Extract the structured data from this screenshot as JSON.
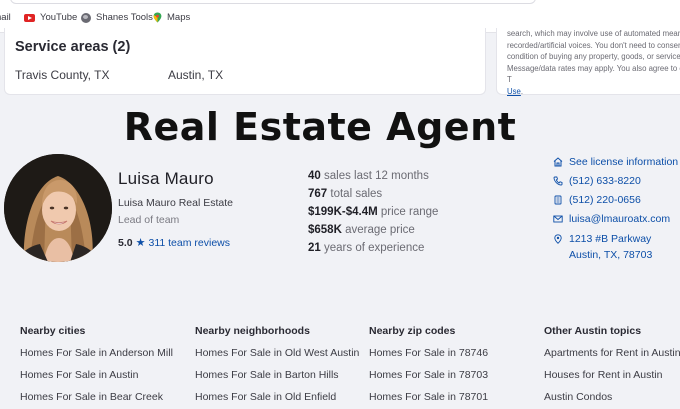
{
  "bookmarks": [
    {
      "label": "nail",
      "icon": ""
    },
    {
      "label": "YouTube",
      "icon": "youtube-icon"
    },
    {
      "label": "Shanes Tools",
      "icon": "globe-icon"
    },
    {
      "label": "Maps",
      "icon": "map-pin-icon"
    }
  ],
  "service_areas": {
    "title": "Service areas (2)",
    "areas": [
      "Travis County, TX",
      "Austin, TX"
    ]
  },
  "disclaimer": {
    "lines": [
      "search, which may involve use of automated means an",
      "recorded/artificial voices. You don't need to consent as",
      "condition of buying any property, goods, or services.",
      "Message/data rates may apply. You also agree to our T"
    ],
    "link_tail": "Use",
    "link_tail_suffix": "."
  },
  "headline": "Real Estate Agent",
  "agent": {
    "name": "Luisa Mauro",
    "company": "Luisa Mauro Real Estate",
    "role": "Lead of team",
    "rating": "5.0",
    "reviews": "311 team reviews"
  },
  "stats": [
    {
      "value": "40",
      "label": "sales last 12 months"
    },
    {
      "value": "767",
      "label": "total sales"
    },
    {
      "value": "$199K-$4.4M",
      "label": "price range"
    },
    {
      "value": "$658K",
      "label": "average price"
    },
    {
      "value": "21",
      "label": "years of experience"
    }
  ],
  "contact": {
    "license": "See license information",
    "phone_mobile": "(512) 633-8220",
    "phone_office": "(512) 220-0656",
    "email": "luisa@lmauroatx.com",
    "address_line1": "1213 #B Parkway",
    "address_line2": "Austin, TX, 78703"
  },
  "footer": {
    "columns": [
      {
        "title": "Nearby cities",
        "items": [
          "Homes For Sale in Anderson Mill",
          "Homes For Sale in Austin",
          "Homes For Sale in Bear Creek"
        ]
      },
      {
        "title": "Nearby neighborhoods",
        "items": [
          "Homes For Sale in Old West Austin",
          "Homes For Sale in Barton Hills",
          "Homes For Sale in Old Enfield"
        ]
      },
      {
        "title": "Nearby zip codes",
        "items": [
          "Homes For Sale in 78746",
          "Homes For Sale in 78703",
          "Homes For Sale in 78701"
        ]
      },
      {
        "title": "Other Austin topics",
        "items": [
          "Apartments for Rent in Austin",
          "Houses for Rent in Austin",
          "Austin Condos"
        ]
      }
    ]
  },
  "colors": {
    "accent": "#0d4fa8",
    "page_bg": "#f1f2f6",
    "card_bg": "#ffffff"
  }
}
